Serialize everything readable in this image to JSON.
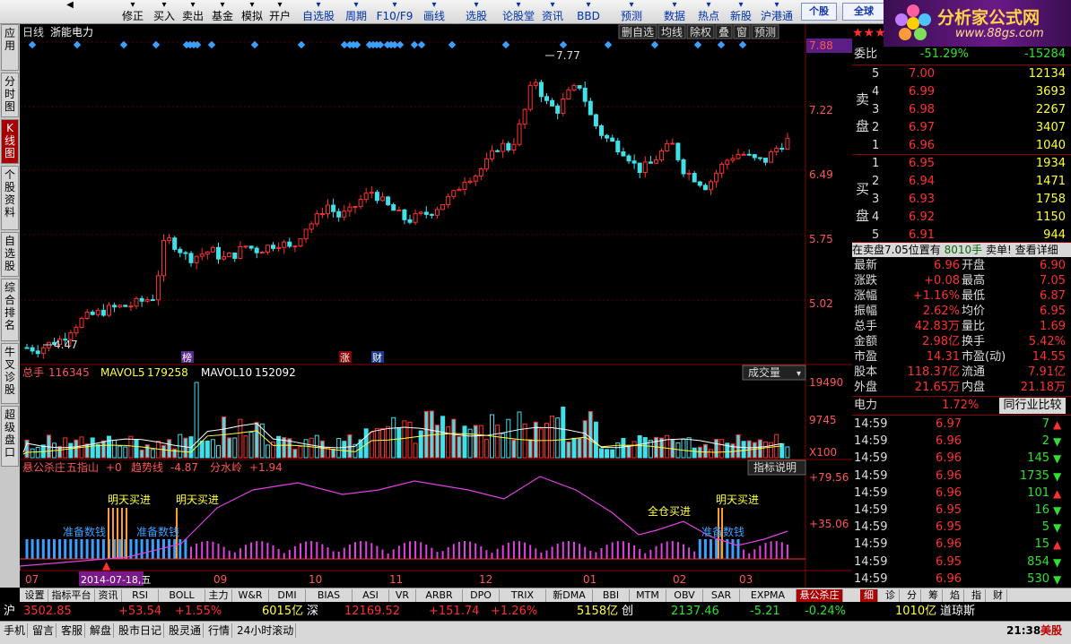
{
  "toolbar": {
    "items": [
      {
        "label": "",
        "icon": "back-icon"
      },
      {
        "label": "修正",
        "icon": "edit-icon"
      },
      {
        "label": "买入",
        "icon": "buy-icon"
      },
      {
        "label": "卖出",
        "icon": "sell-icon"
      },
      {
        "label": "基金",
        "icon": "fund-icon"
      },
      {
        "label": "模拟",
        "icon": "simulate-icon"
      },
      {
        "label": "开户",
        "icon": "account-icon"
      },
      {
        "label": "自选股",
        "icon": ""
      },
      {
        "label": "周期",
        "icon": ""
      },
      {
        "label": "F10/F9",
        "icon": ""
      },
      {
        "label": "画线",
        "icon": ""
      },
      {
        "label": "选股",
        "icon": ""
      },
      {
        "label": "论股堂",
        "icon": ""
      },
      {
        "label": "资讯",
        "icon": ""
      },
      {
        "label": "BBD",
        "icon": ""
      },
      {
        "label": "预测",
        "icon": ""
      },
      {
        "label": "数据",
        "icon": ""
      },
      {
        "label": "热点",
        "icon": ""
      },
      {
        "label": "新股",
        "icon": ""
      },
      {
        "label": "沪港通",
        "icon": ""
      }
    ],
    "stock_btn": "个股",
    "global_btn": "全球"
  },
  "logo": {
    "title": "分析家公式网",
    "url": "www.88gs.com"
  },
  "left_tabs": [
    "应用",
    "分时图",
    "K线图",
    "个股资料",
    "自选股",
    "综合排名",
    "牛叉诊股",
    "超级盘口"
  ],
  "chart": {
    "period": "日线",
    "stock_name": "浙能电力",
    "top_buttons": [
      "删自选",
      "均线",
      "除权",
      "叠",
      "窗",
      "预测"
    ],
    "price_axis": [
      "7.88",
      "7.22",
      "6.49",
      "5.75",
      "5.02"
    ],
    "high_mark": "7.77",
    "low_mark": "4.47",
    "event_marks": [
      "榜",
      "涨",
      "财"
    ],
    "vol_legend": {
      "label": "总手",
      "value": "116345",
      "ma5_label": "MAVOL5",
      "ma5": "179258",
      "ma10_label": "MAVOL10",
      "ma10": "152092"
    },
    "vol_axis": [
      "19490",
      "9745",
      "X100"
    ],
    "vol_dropdown": "成交量",
    "ind_legend": {
      "name": "悬公杀庄",
      "l1": "五指山",
      "v1": "+0",
      "l2": "趋势线",
      "v2": "-4.87",
      "l3": "分水岭",
      "v3": "+1.94"
    },
    "ind_button": "指标说明",
    "ind_axis": [
      "+79.56",
      "+35.06"
    ],
    "ind_labels": [
      "明天买进",
      "明天买进",
      "全仓买进",
      "明天买进",
      "准备数钱",
      "准备数钱",
      "准备数钱"
    ],
    "date_cursor": "2014-07-18,五",
    "months": [
      "07",
      "09",
      "10",
      "11",
      "12",
      "01",
      "02",
      "03"
    ]
  },
  "chart_data": {
    "type": "candlestick",
    "x_range": [
      "2014-07",
      "2015-03"
    ],
    "ylim": [
      4.3,
      7.95
    ],
    "high": 7.77,
    "low": 4.47,
    "close_path": [
      4.5,
      4.48,
      4.55,
      4.6,
      4.75,
      4.85,
      4.9,
      4.95,
      4.98,
      5.0,
      5.05,
      5.1,
      5.8,
      5.7,
      5.55,
      5.6,
      5.65,
      5.55,
      5.6,
      5.7,
      5.65,
      5.7,
      5.75,
      5.65,
      5.9,
      6.0,
      6.2,
      6.05,
      6.1,
      6.25,
      6.35,
      6.2,
      6.1,
      6.0,
      6.05,
      6.1,
      6.2,
      6.3,
      6.5,
      6.55,
      6.7,
      6.9,
      6.85,
      7.2,
      7.7,
      7.4,
      7.3,
      7.5,
      7.6,
      7.2,
      7.0,
      6.9,
      6.8,
      6.6,
      6.65,
      6.8,
      6.9,
      6.6,
      6.5,
      6.4,
      6.6,
      6.75,
      6.8,
      6.72,
      6.7,
      6.85,
      6.95
    ]
  },
  "quote": {
    "stars": "★★★",
    "weibi_label": "委比",
    "weibi": "-51.29%",
    "weicha": "-15284",
    "sell_label": "卖盘",
    "asks": [
      {
        "lvl": "5",
        "price": "7.00",
        "vol": "12134"
      },
      {
        "lvl": "4",
        "price": "6.99",
        "vol": "3693"
      },
      {
        "lvl": "3",
        "price": "6.98",
        "vol": "2267"
      },
      {
        "lvl": "2",
        "price": "6.97",
        "vol": "3407"
      },
      {
        "lvl": "1",
        "price": "6.96",
        "vol": "1040"
      }
    ],
    "buy_label": "买盘",
    "bids": [
      {
        "lvl": "1",
        "price": "6.95",
        "vol": "1934"
      },
      {
        "lvl": "2",
        "price": "6.94",
        "vol": "1471"
      },
      {
        "lvl": "3",
        "price": "6.93",
        "vol": "1758"
      },
      {
        "lvl": "4",
        "price": "6.92",
        "vol": "1150"
      },
      {
        "lvl": "5",
        "price": "6.91",
        "vol": "944"
      }
    ],
    "notice": "在卖盘7.05位置有",
    "notice_vol": "8010手",
    "notice_tail": "卖单!",
    "notice_link": "查看详细",
    "stats": [
      {
        "l": "最新",
        "v": "6.96",
        "l2": "开盘",
        "v2": "6.90"
      },
      {
        "l": "涨跌",
        "v": "+0.08",
        "l2": "最高",
        "v2": "7.05"
      },
      {
        "l": "涨幅",
        "v": "+1.16%",
        "l2": "最低",
        "v2": "6.87"
      },
      {
        "l": "振幅",
        "v": "2.62%",
        "l2": "均价",
        "v2": "6.95"
      },
      {
        "l": "总手",
        "v": "42.83万",
        "l2": "量比",
        "v2": "1.69"
      },
      {
        "l": "金额",
        "v": "2.98亿",
        "l2": "换手",
        "v2": "5.42%"
      },
      {
        "l": "市盈",
        "v": "14.31",
        "l2": "市盈(动)",
        "v2": "14.55"
      },
      {
        "l": "股本",
        "v": "118.37亿",
        "l2": "流通",
        "v2": "7.91亿"
      },
      {
        "l": "外盘",
        "v": "21.65万",
        "l2": "内盘",
        "v2": "21.18万"
      }
    ],
    "sector": "电力",
    "sector_pct": "1.72%",
    "sector_cmp": "同行业比较",
    "ticks": [
      {
        "t": "14:59",
        "p": "6.97",
        "v": "7",
        "d": "up"
      },
      {
        "t": "14:59",
        "p": "6.96",
        "v": "2",
        "d": "down"
      },
      {
        "t": "14:59",
        "p": "6.96",
        "v": "145",
        "d": "down"
      },
      {
        "t": "14:59",
        "p": "6.96",
        "v": "1735",
        "d": "down"
      },
      {
        "t": "14:59",
        "p": "6.96",
        "v": "101",
        "d": "up"
      },
      {
        "t": "14:59",
        "p": "6.95",
        "v": "16",
        "d": "down"
      },
      {
        "t": "14:59",
        "p": "6.95",
        "v": "5",
        "d": "down"
      },
      {
        "t": "14:59",
        "p": "6.96",
        "v": "15",
        "d": "up"
      },
      {
        "t": "14:59",
        "p": "6.95",
        "v": "854",
        "d": "down"
      },
      {
        "t": "14:59",
        "p": "6.96",
        "v": "530",
        "d": "down"
      }
    ]
  },
  "bottom_tabs": [
    "设置",
    "指标平台",
    "资讯",
    "RSI",
    "BOLL",
    "主力",
    "W&R",
    "DMI",
    "BIAS",
    "ASI",
    "VR",
    "ARBR",
    "DPO",
    "TRIX",
    "新DMA",
    "BBI",
    "MTM",
    "OBV",
    "SAR",
    "EXPMA",
    "悬公杀庄"
  ],
  "right_tabs": [
    "细",
    "诊",
    "分",
    "筹",
    "焰",
    "指",
    "财"
  ],
  "ticker": {
    "sh_label": "沪",
    "sh": "3502.85",
    "sh_chg": "+53.54",
    "sh_pct": "+1.55%",
    "sh_amt": "6015亿",
    "sz_label": "深",
    "sz": "12169.52",
    "sz_chg": "+151.74",
    "sz_pct": "+1.26%",
    "sz_amt": "5158亿",
    "cy_label": "创",
    "cy": "2137.46",
    "cy_chg": "-5.21",
    "cy_pct": "-0.24%",
    "cy_amt": "1010亿",
    "dj_label": "道琼斯"
  },
  "status": {
    "items": [
      "手机",
      "留言",
      "客服",
      "解盘",
      "股市日记",
      "股灵通",
      "行情",
      "24小时滚动"
    ],
    "time": "21:38",
    "market": "美股"
  }
}
